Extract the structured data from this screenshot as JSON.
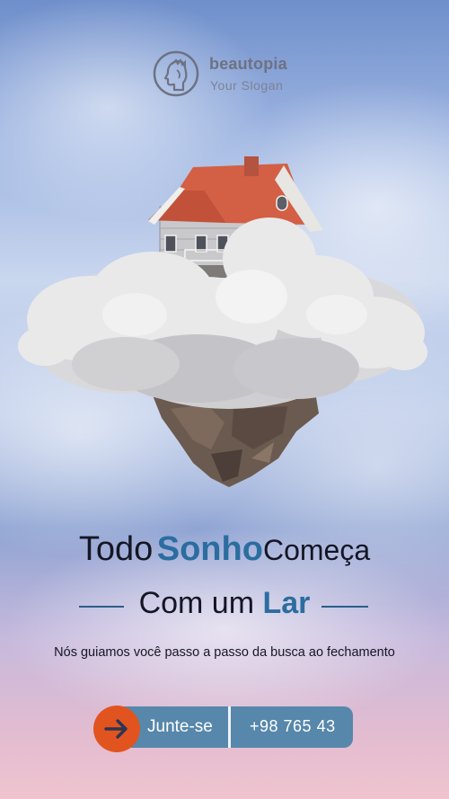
{
  "brand": {
    "name": "beautopia",
    "slogan": "Your Slogan"
  },
  "headline": {
    "word1": "Todo",
    "accent1": "Sonho",
    "word2": "Começa",
    "line2_plain": "Com um",
    "line2_accent": "Lar"
  },
  "tagline": "Nós guiamos você passo a passo da busca ao fechamento",
  "cta": {
    "join_label": "Junte-se",
    "phone": "+98 765 43",
    "icon": "arrow-right-icon"
  },
  "colors": {
    "accent_blue": "#2b6da0",
    "button_blue": "#5787ab",
    "button_orange": "#e2541f",
    "text_dark": "#141625"
  }
}
